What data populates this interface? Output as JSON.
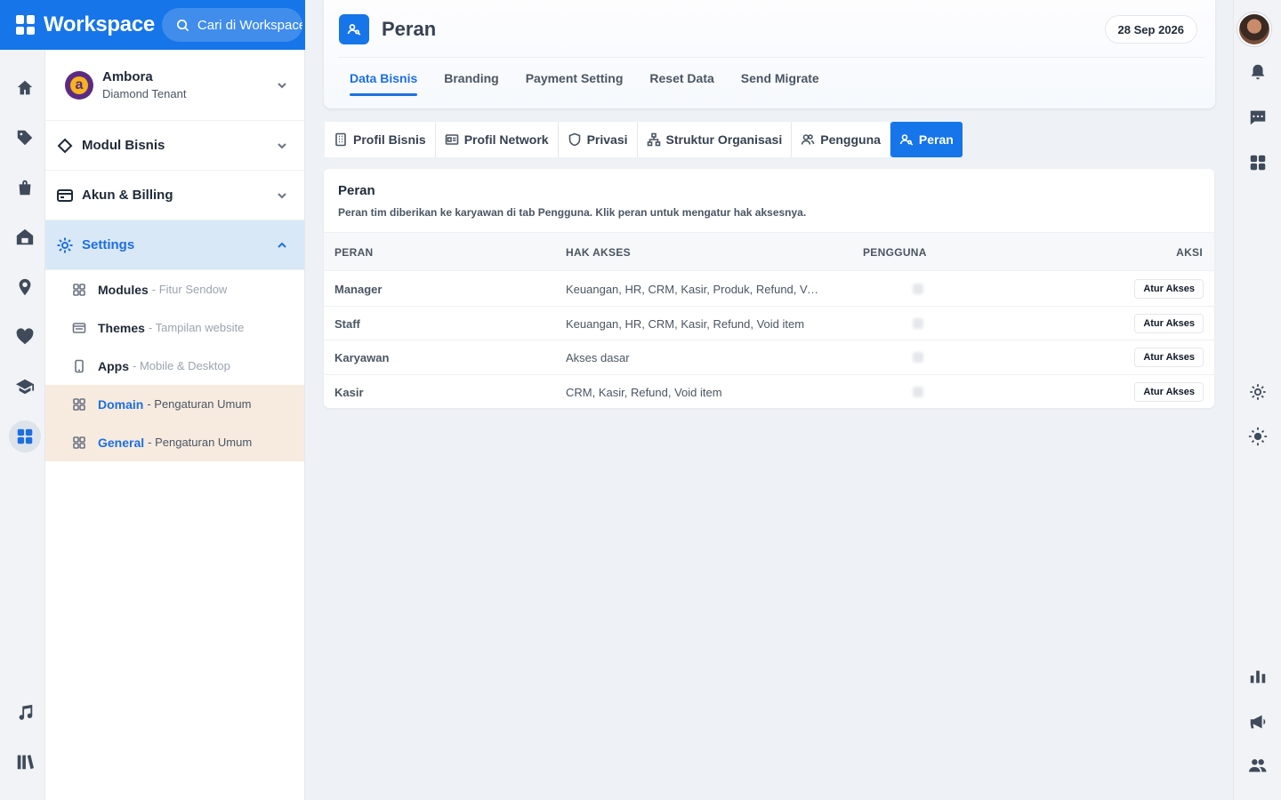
{
  "brand": {
    "name": "Workspace",
    "search_placeholder": "Cari di Workspace"
  },
  "tenant": {
    "name": "Ambora",
    "plan": "Diamond Tenant"
  },
  "sidebar": {
    "menus": [
      {
        "label": "Modul Bisnis"
      },
      {
        "label": "Akun & Billing"
      },
      {
        "label": "Settings"
      }
    ],
    "sub_items": [
      {
        "label": "Modules",
        "desc": "- Fitur Sendow"
      },
      {
        "label": "Themes",
        "desc": "- Tampilan website"
      },
      {
        "label": "Apps",
        "desc": "- Mobile & Desktop"
      },
      {
        "label": "Domain",
        "desc": "- Pengaturan Umum"
      },
      {
        "label": "General",
        "desc": "- Pengaturan Umum"
      }
    ]
  },
  "header": {
    "title": "Peran",
    "date": "28 Sep 2026",
    "tabs": [
      "Data Bisnis",
      "Branding",
      "Payment Setting",
      "Reset Data",
      "Send Migrate"
    ],
    "active_tab": "Data Bisnis"
  },
  "subtabs": [
    {
      "label": "Profil Bisnis",
      "icon": "building-icon"
    },
    {
      "label": "Profil Network",
      "icon": "id-card-icon"
    },
    {
      "label": "Privasi",
      "icon": "shield-icon"
    },
    {
      "label": "Struktur Organisasi",
      "icon": "org-chart-icon"
    },
    {
      "label": "Pengguna",
      "icon": "users-icon"
    },
    {
      "label": "Peran",
      "icon": "user-key-icon"
    }
  ],
  "roles_table": {
    "title": "Peran",
    "description": "Peran tim diberikan ke karyawan di tab Pengguna. Klik peran untuk mengatur hak aksesnya.",
    "columns": [
      "PERAN",
      "HAK AKSES",
      "PENGGUNA",
      "AKSI"
    ],
    "action_label": "Atur Akses",
    "rows": [
      {
        "role": "Manager",
        "access": "Keuangan, HR, CRM, Kasir, Produk, Refund, Void item",
        "users": "0"
      },
      {
        "role": "Staff",
        "access": "Keuangan, HR, CRM, Kasir, Refund, Void item",
        "users": "0"
      },
      {
        "role": "Karyawan",
        "access": "Akses dasar",
        "users": "0"
      },
      {
        "role": "Kasir",
        "access": "CRM, Kasir, Refund, Void item",
        "users": "0"
      }
    ]
  },
  "colors": {
    "primary": "#1675e8",
    "sidebar_active_bg": "#d9e8f7",
    "highlight_bg": "#f7ebe0"
  }
}
